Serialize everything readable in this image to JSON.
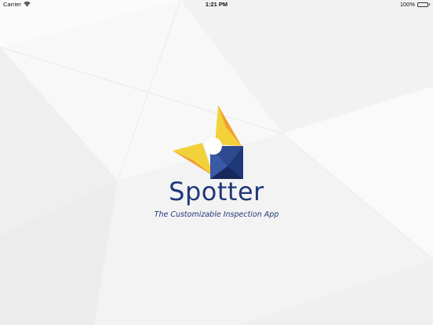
{
  "status_bar": {
    "carrier": "Carrier",
    "time": "1:21 PM",
    "battery": "100%",
    "wifi_icon": "wifi-icon",
    "battery_icon": "battery-icon",
    "battery_level": 1.0,
    "battery_color": "#4cd964"
  },
  "splash": {
    "app_name": "Spotter",
    "tagline": "The Customizable Inspection App",
    "logo_icon": "spotter-logo-icon",
    "brand_colors": {
      "navy": "#1f3877",
      "yellow": "#f2d13a",
      "orange": "#f0a030"
    }
  }
}
